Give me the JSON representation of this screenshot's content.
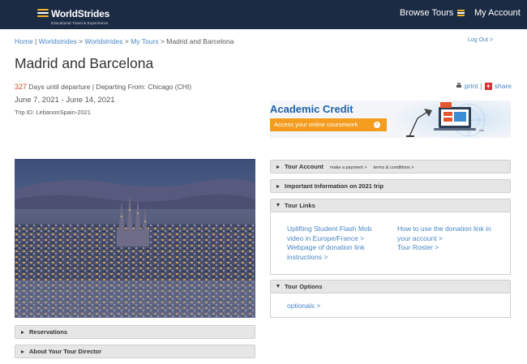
{
  "header": {
    "logo_text": "WorldStrides",
    "logo_tagline": "Educational Travel & Experiences",
    "nav_browse": "Browse Tours",
    "nav_account": "My Account"
  },
  "breadcrumb": {
    "items": [
      "Home",
      "Worldstrides",
      "Worldstrides",
      "My Tours"
    ],
    "separators": [
      "|",
      ">",
      ">",
      ">"
    ],
    "current": "Madrid and Barcelona"
  },
  "logout": "Log Out >",
  "trip": {
    "title": "Madrid and Barcelona",
    "days_count": "327",
    "days_label": "Days until departure",
    "departing": "| Departing From: Chicago (CHI)",
    "dates": "June 7, 2021 - June 14, 2021",
    "trip_id": "Trip ID: LebanonSpain-2021"
  },
  "actions": {
    "print": "print",
    "separator": "|",
    "share": "share"
  },
  "academic_credit": {
    "title": "Academic Credit",
    "button": "Access your online coursework",
    "arrow": "›"
  },
  "left_panels": [
    {
      "label": "Reservations"
    },
    {
      "label": "About Your Tour Director"
    }
  ],
  "right_panels": {
    "tour_account": {
      "label": "Tour Account",
      "links": [
        "make a payment >",
        "terms & conditions >"
      ]
    },
    "important_info": {
      "label": "Important Information on 2021 trip"
    },
    "tour_links": {
      "label": "Tour Links",
      "col1": [
        "Uplifting Student Flash Mob",
        "video in Europe/France >",
        "Webpage of donation link",
        "instructions >"
      ],
      "col2": [
        "How to use the donation link in",
        "your account >",
        "Tour Roster >"
      ]
    },
    "tour_options": {
      "label": "Tour Options",
      "link": "optionals >"
    }
  },
  "colors": {
    "header_bg": "#1c2b44",
    "link": "#4a86c5",
    "accent_orange": "#f39c1e",
    "credit_blue": "#1f63a8",
    "days_red": "#c0502a"
  }
}
